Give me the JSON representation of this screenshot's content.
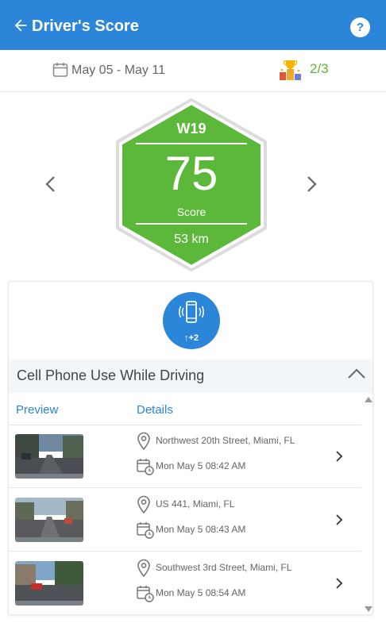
{
  "header": {
    "title": "Driver's Score",
    "help_label": "?",
    "color": "#2b86da"
  },
  "datebar": {
    "date_range": "May 05 - May 11",
    "trophy_count": "2/3",
    "icons": [
      "calendar-icon",
      "trophy-podium-icon"
    ]
  },
  "score": {
    "week": "W19",
    "value": "75",
    "label": "Score",
    "distance": "53 km",
    "color": "#5cb83a"
  },
  "event": {
    "icon": "phone-vibrate-icon",
    "count_label": "↑+2",
    "title": "Cell Phone Use While Driving"
  },
  "table": {
    "columns": [
      "Preview",
      "Details"
    ],
    "rows": [
      {
        "address": "Northwest 20th Street, Miami, FL",
        "time": "Mon May 5 08:42 AM"
      },
      {
        "address": "US 441, Miami, FL",
        "time": "Mon May 5 08:43 AM"
      },
      {
        "address": "Southwest 3rd Street, Miami, FL",
        "time": "Mon May 5 08:54 AM"
      }
    ]
  }
}
